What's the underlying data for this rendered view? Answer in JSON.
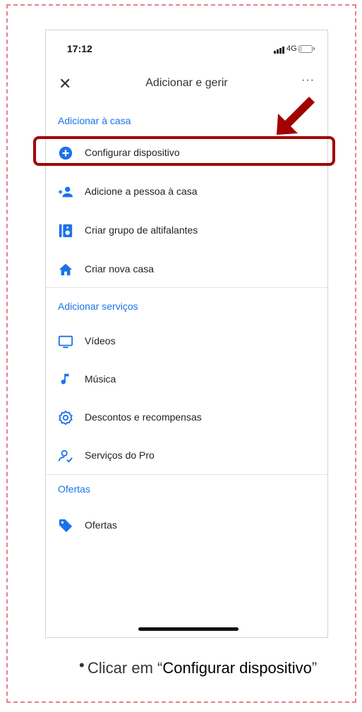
{
  "status_bar": {
    "time": "17:12",
    "network": "4G"
  },
  "header": {
    "title": "Adicionar e gerir",
    "close_glyph": "✕",
    "more_glyph": "···"
  },
  "sections": [
    {
      "title": "Adicionar à casa",
      "items": [
        {
          "label": "Configurar dispositivo",
          "icon": "add-circle-icon"
        },
        {
          "label": "Adicione a pessoa à casa",
          "icon": "add-person-icon"
        },
        {
          "label": "Criar grupo de altifalantes",
          "icon": "speaker-group-icon"
        },
        {
          "label": "Criar nova casa",
          "icon": "home-icon"
        }
      ]
    },
    {
      "title": "Adicionar serviços",
      "items": [
        {
          "label": "Vídeos",
          "icon": "tv-icon"
        },
        {
          "label": "Música",
          "icon": "music-note-icon"
        },
        {
          "label": "Descontos e recompensas",
          "icon": "offer-badge-icon"
        },
        {
          "label": "Serviços do Pro",
          "icon": "pro-services-icon"
        }
      ]
    },
    {
      "title": "Ofertas",
      "items": [
        {
          "label": "Ofertas",
          "icon": "tag-icon"
        }
      ]
    }
  ],
  "caption": {
    "bullet": "•",
    "prefix": "Clicar em “",
    "emphasis": "Configurar dispositivo",
    "suffix": "”"
  },
  "colors": {
    "accent": "#1a73e8",
    "highlight": "#a30000",
    "frame": "#e8808a"
  }
}
